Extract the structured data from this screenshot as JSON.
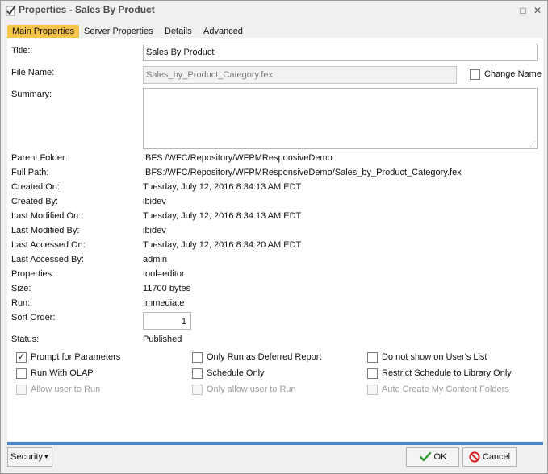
{
  "window": {
    "title": "Properties - Sales By Product",
    "maximize_symbol": "□",
    "close_symbol": "✕"
  },
  "tabs": [
    {
      "label": "Main Properties",
      "active": true
    },
    {
      "label": "Server Properties",
      "active": false
    },
    {
      "label": "Details",
      "active": false
    },
    {
      "label": "Advanced",
      "active": false
    }
  ],
  "form": {
    "title_label": "Title:",
    "title_value": "Sales By Product",
    "file_name_label": "File Name:",
    "file_name_value": "Sales_by_Product_Category.fex",
    "change_name_label": "Change Name",
    "summary_label": "Summary:",
    "summary_value": ""
  },
  "properties": [
    {
      "label": "Parent Folder:",
      "value": "IBFS:/WFC/Repository/WFPMResponsiveDemo"
    },
    {
      "label": "Full Path:",
      "value": "IBFS:/WFC/Repository/WFPMResponsiveDemo/Sales_by_Product_Category.fex"
    },
    {
      "label": "Created On:",
      "value": "Tuesday, July 12, 2016 8:34:13 AM EDT"
    },
    {
      "label": "Created By:",
      "value": "ibidev"
    },
    {
      "label": "Last Modified On:",
      "value": "Tuesday, July 12, 2016 8:34:13 AM EDT"
    },
    {
      "label": "Last Modified By:",
      "value": "ibidev"
    },
    {
      "label": "Last Accessed On:",
      "value": "Tuesday, July 12, 2016 8:34:20 AM EDT"
    },
    {
      "label": "Last Accessed By:",
      "value": "admin"
    },
    {
      "label": "Properties:",
      "value": "tool=editor"
    },
    {
      "label": "Size:",
      "value": "11700 bytes"
    },
    {
      "label": "Run:",
      "value": "Immediate"
    }
  ],
  "sort_order": {
    "label": "Sort Order:",
    "value": "1"
  },
  "status": {
    "label": "Status:",
    "value": "Published"
  },
  "options": {
    "col1": [
      {
        "label": "Prompt for Parameters",
        "checked": true,
        "disabled": false
      },
      {
        "label": "Run With OLAP",
        "checked": false,
        "disabled": false
      },
      {
        "label": "Allow user to Run",
        "checked": false,
        "disabled": true
      }
    ],
    "col2": [
      {
        "label": "Only Run as Deferred Report",
        "checked": false,
        "disabled": false
      },
      {
        "label": "Schedule Only",
        "checked": false,
        "disabled": false
      },
      {
        "label": "Only allow user to Run",
        "checked": false,
        "disabled": true
      }
    ],
    "col3": [
      {
        "label": "Do not show on User's List",
        "checked": false,
        "disabled": false
      },
      {
        "label": "Restrict Schedule to Library Only",
        "checked": false,
        "disabled": false
      },
      {
        "label": "Auto Create My Content Folders",
        "checked": false,
        "disabled": true
      }
    ]
  },
  "footer": {
    "security_label": "Security",
    "ok_label": "OK",
    "cancel_label": "Cancel"
  },
  "colors": {
    "accent_tab": "#f6c44a",
    "footer_line": "#4a84c8",
    "ok_icon": "#2e9a2e",
    "cancel_icon": "#d42020"
  }
}
